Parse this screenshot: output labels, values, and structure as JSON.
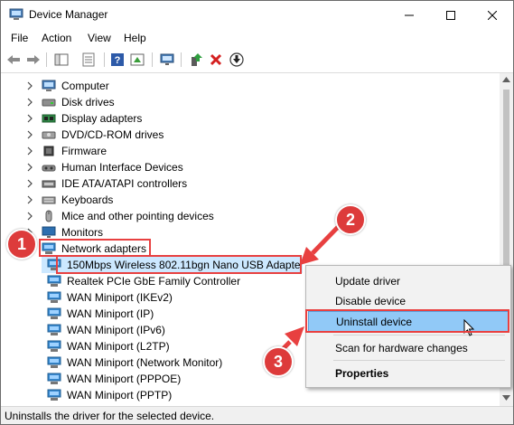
{
  "window": {
    "title": "Device Manager",
    "controls": [
      "minimize",
      "maximize",
      "close"
    ]
  },
  "menubar": [
    "File",
    "Action",
    "View",
    "Help"
  ],
  "tree": {
    "categories": [
      {
        "label": "Computer",
        "icon": "computer-icon"
      },
      {
        "label": "Disk drives",
        "icon": "disk-drive-icon"
      },
      {
        "label": "Display adapters",
        "icon": "display-adapter-icon"
      },
      {
        "label": "DVD/CD-ROM drives",
        "icon": "dvd-drive-icon"
      },
      {
        "label": "Firmware",
        "icon": "firmware-icon"
      },
      {
        "label": "Human Interface Devices",
        "icon": "hid-icon"
      },
      {
        "label": "IDE ATA/ATAPI controllers",
        "icon": "ide-controller-icon"
      },
      {
        "label": "Keyboards",
        "icon": "keyboard-icon"
      },
      {
        "label": "Mice and other pointing devices",
        "icon": "mouse-icon"
      },
      {
        "label": "Monitors",
        "icon": "monitor-icon"
      }
    ],
    "expanded": {
      "label": "Network adapters",
      "icon": "network-adapter-icon"
    },
    "children": [
      "150Mbps Wireless 802.11bgn Nano USB Adapte",
      "Realtek PCIe GbE Family Controller",
      "WAN Miniport (IKEv2)",
      "WAN Miniport (IP)",
      "WAN Miniport (IPv6)",
      "WAN Miniport (L2TP)",
      "WAN Miniport (Network Monitor)",
      "WAN Miniport (PPPOE)",
      "WAN Miniport (PPTP)"
    ]
  },
  "context_menu": {
    "update": "Update driver",
    "disable": "Disable device",
    "uninstall": "Uninstall device",
    "scan": "Scan for hardware changes",
    "properties": "Properties"
  },
  "annotations": {
    "step1": "1",
    "step2": "2",
    "step3": "3",
    "color": "#e84040"
  },
  "status_text": "Uninstalls the driver for the selected device.",
  "colors": {
    "selection": "#cce8ff",
    "menu_highlight": "#91c9f7",
    "annotation": "#e84040"
  }
}
